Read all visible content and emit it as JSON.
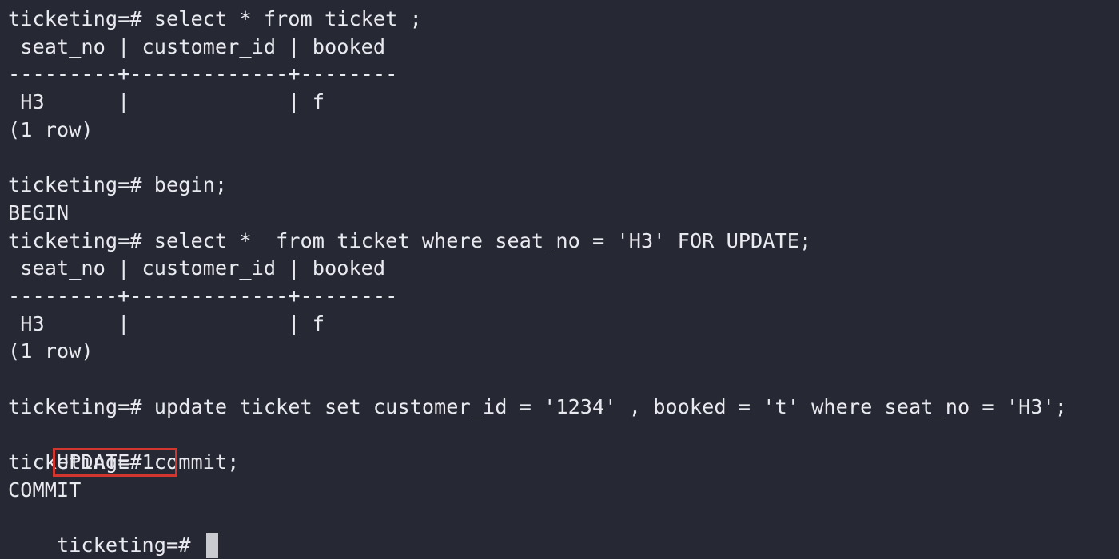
{
  "terminal": {
    "lines": [
      "ticketing=# select * from ticket ;",
      " seat_no | customer_id | booked",
      "---------+-------------+--------",
      " H3      |             | f",
      "(1 row)",
      "",
      "ticketing=# begin;",
      "BEGIN",
      "ticketing=# select *  from ticket where seat_no = 'H3' FOR UPDATE;",
      " seat_no | customer_id | booked",
      "---------+-------------+--------",
      " H3      |             | f",
      "(1 row)",
      "",
      "ticketing=# update ticket set customer_id = '1234' , booked = 't' where seat_no = 'H3';",
      "UPDATE 1",
      "ticketing=# commit;",
      "COMMIT",
      "ticketing=# "
    ],
    "highlight_color": "#d3362f",
    "background_color": "#262833",
    "text_color": "#e9eaf0"
  }
}
